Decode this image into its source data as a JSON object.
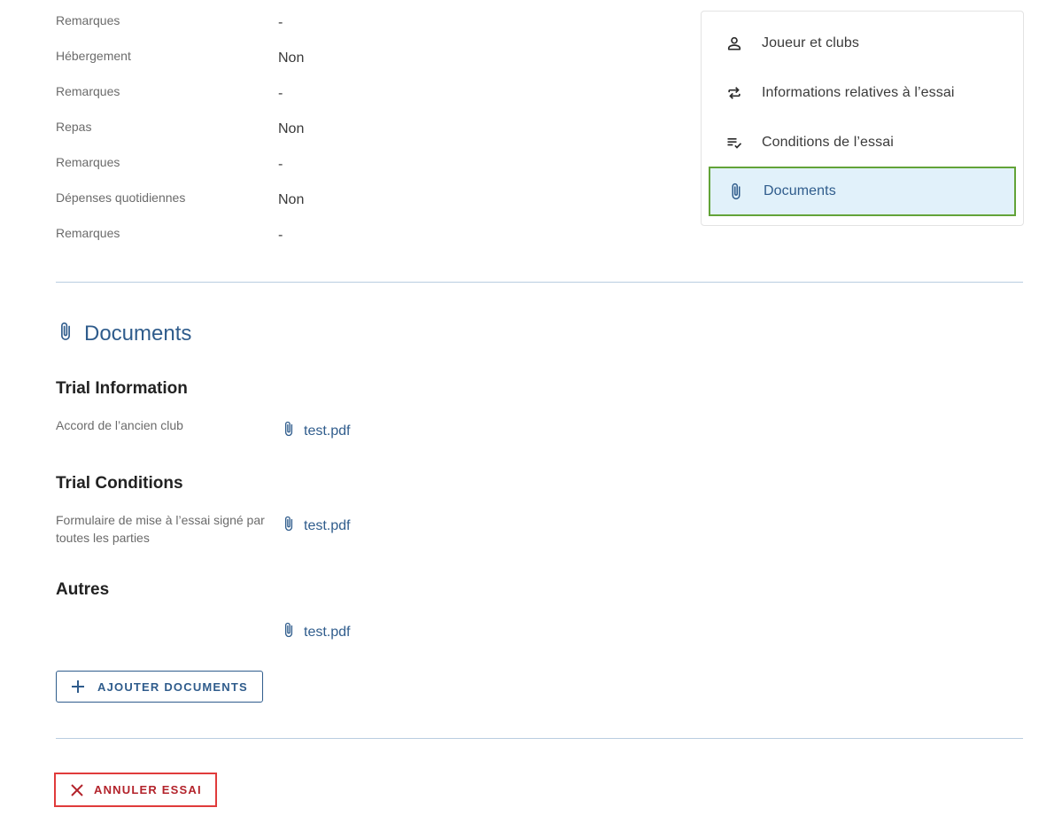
{
  "details": [
    {
      "label": "Remarques",
      "value": "-"
    },
    {
      "label": "Hébergement",
      "value": "Non"
    },
    {
      "label": "Remarques",
      "value": "-"
    },
    {
      "label": "Repas",
      "value": "Non"
    },
    {
      "label": "Remarques",
      "value": "-"
    },
    {
      "label": "Dépenses quotidiennes",
      "value": "Non"
    },
    {
      "label": "Remarques",
      "value": "-"
    }
  ],
  "nav": {
    "items": [
      {
        "label": "Joueur et clubs",
        "icon": "person-icon"
      },
      {
        "label": "Informations relatives à l’essai",
        "icon": "swap-icon"
      },
      {
        "label": "Conditions de l’essai",
        "icon": "checklist-icon"
      },
      {
        "label": "Documents",
        "icon": "paperclip-icon",
        "active": true
      }
    ]
  },
  "documents": {
    "title": "Documents",
    "groups": [
      {
        "heading": "Trial Information",
        "label": "Accord de l’ancien club",
        "file": "test.pdf"
      },
      {
        "heading": "Trial Conditions",
        "label": "Formulaire de mise à l’essai signé par toutes les parties",
        "file": "test.pdf"
      },
      {
        "heading": "Autres",
        "label": "",
        "file": "test.pdf"
      }
    ],
    "add_button": "AJOUTER DOCUMENTS"
  },
  "cancel_button": "ANNULER ESSAI",
  "colors": {
    "accent": "#2f5c8c",
    "active_bg": "#e1f1fa",
    "active_border": "#62a338",
    "danger": "#b3232b",
    "danger_border": "#e03b3b"
  }
}
